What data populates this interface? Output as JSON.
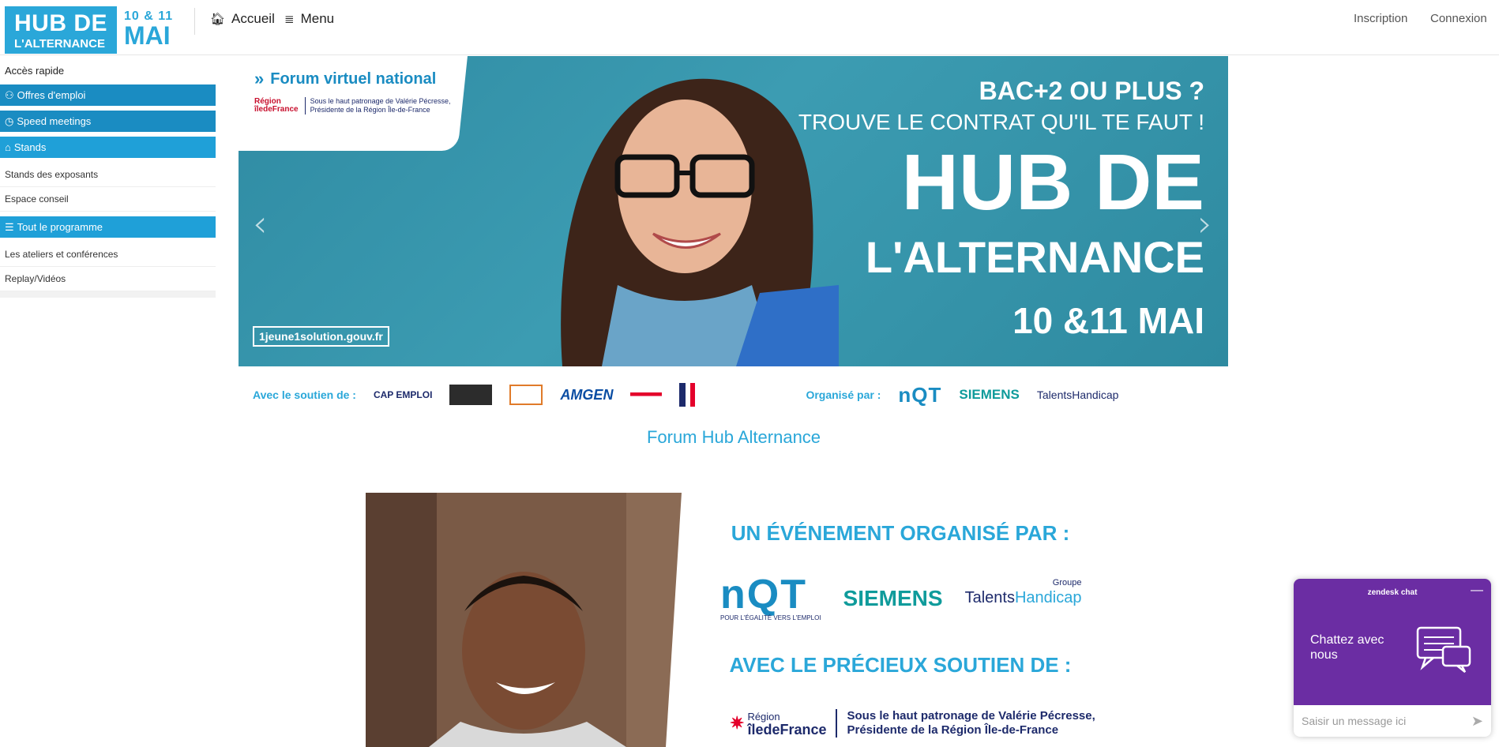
{
  "header": {
    "logo_line1": "HUB DE",
    "logo_line2": "L'ALTERNANCE",
    "date_line1": "10 & 11",
    "date_line2": "MAI",
    "nav_home": "Accueil",
    "nav_menu": "Menu",
    "signup": "Inscription",
    "login": "Connexion"
  },
  "sidebar": {
    "title": "Accès rapide",
    "items": [
      {
        "label": "Offres d'emploi",
        "style": "blue"
      },
      {
        "label": "Speed meetings",
        "style": "blue"
      },
      {
        "label": "Stands",
        "style": "light"
      },
      {
        "label": "Stands des exposants",
        "style": "link"
      },
      {
        "label": "Espace conseil",
        "style": "link"
      },
      {
        "label": "Tout le programme",
        "style": "light"
      },
      {
        "label": "Les ateliers et conférences",
        "style": "link"
      },
      {
        "label": "Replay/Vidéos",
        "style": "link"
      }
    ]
  },
  "banner": {
    "forum_title": "Forum virtuel national",
    "region_logo_line1": "Région",
    "region_logo_line2": "îledeFrance",
    "patronage_line1": "Sous le haut patronage de Valérie Pécresse,",
    "patronage_line2": "Présidente de la Région Île-de-France",
    "headline1": "BAC+2 OU PLUS ?",
    "headline2": "TROUVE LE CONTRAT QU'IL TE FAUT !",
    "headline3": "HUB DE",
    "headline4": "L'ALTERNANCE",
    "headline5": "10 &11 MAI",
    "gov_badge": "1jeune1solution.gouv.fr"
  },
  "sponsors": {
    "support_label": "Avec le soutien de :",
    "organized_label": "Organisé par :",
    "support_logos": [
      "CAP EMPLOI",
      "AMGEN"
    ],
    "organizer_logos": [
      "nQT",
      "SIEMENS",
      "TalentsHandicap"
    ]
  },
  "page_title": "Forum Hub Alternance",
  "content": {
    "org_title": "UN ÉVÉNEMENT ORGANISÉ PAR :",
    "nqt": "nQT",
    "nqt_sub": "POUR L'ÉGALITÉ VERS L'EMPLOI",
    "siemens": "SIEMENS",
    "talents_a": "Talents",
    "talents_b": "Handicap",
    "talents_group": "Groupe",
    "support_title": "AVEC LE PRÉCIEUX SOUTIEN DE :",
    "region_line1": "Région",
    "region_line2": "îledeFrance",
    "patronage_line1": "Sous le haut patronage de Valérie Pécresse,",
    "patronage_line2": "Présidente de la Région Île-de-France"
  },
  "chat": {
    "brand": "zendesk chat",
    "minimize": "—",
    "message": "Chattez avec nous",
    "placeholder": "Saisir un message ici"
  },
  "colors": {
    "accent": "#2aa7d9",
    "sidebar_blue": "#1a8cc2",
    "chat_purple": "#6b2da3",
    "banner_bg": "#3c9cb2"
  }
}
